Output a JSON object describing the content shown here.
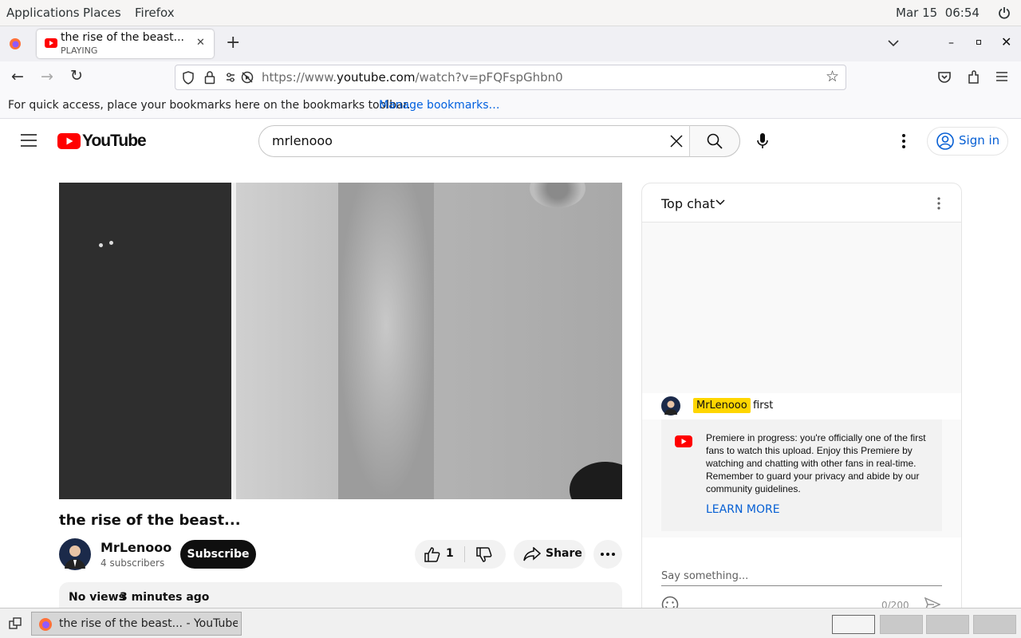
{
  "topbar": {
    "menus": [
      "Applications",
      "Places",
      "Firefox"
    ],
    "datetime": "Mar 15  06:54"
  },
  "browser": {
    "tab": {
      "title": "the rise of the beast... - YouTube",
      "status": "PLAYING"
    },
    "url_prefix": "https://www.",
    "url_domain": "youtube.com",
    "url_path": "/watch?v=pFQFspGhbn0",
    "bookmarks_hint": "For quick access, place your bookmarks here on the bookmarks toolbar.",
    "bookmarks_link": "Manage bookmarks…"
  },
  "youtube": {
    "logo_text": "YouTube",
    "search_value": "mrlenooo",
    "signin_label": "Sign in",
    "video": {
      "title": "the rise of the beast...",
      "channel": "MrLenooo",
      "subscribers": "4 subscribers",
      "subscribe_label": "Subscribe",
      "likes": "1",
      "share_label": "Share",
      "views": "No views",
      "time_ago": "3 minutes ago"
    },
    "chat": {
      "header": "Top chat",
      "message_author": "MrLenooo",
      "message_text": "first",
      "notice": "Premiere in progress: you're officially one of the first fans to watch this upload. Enjoy this Premiere by watching and chatting with other fans in real-time. Remember to guard your privacy and abide by our community guidelines.",
      "learn_more": "LEARN MORE",
      "input_placeholder": "Say something...",
      "char_count": "0/200"
    }
  },
  "taskbar": {
    "window_title": "the rise of the beast... - YouTube —..."
  },
  "colors": {
    "youtube_red": "#ff0000",
    "link_blue": "#065fd4",
    "author_highlight": "#ffd600"
  }
}
